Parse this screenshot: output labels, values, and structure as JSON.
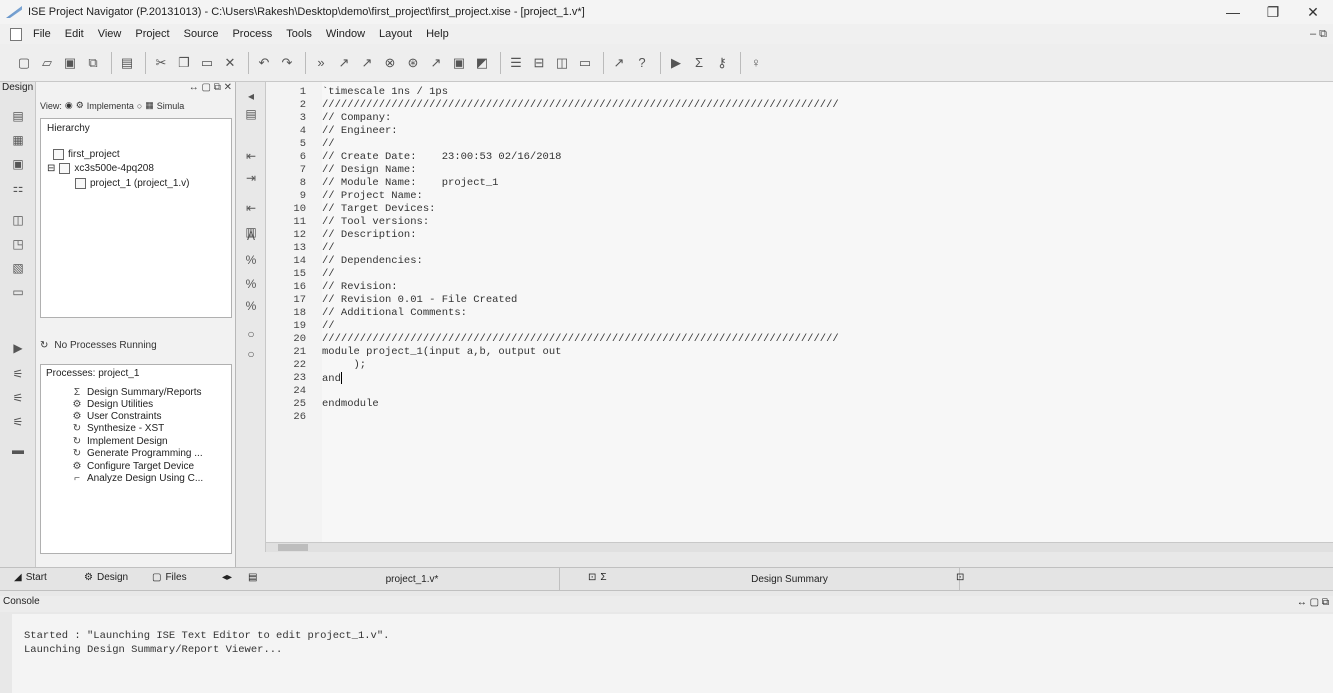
{
  "window": {
    "title": "ISE Project Navigator (P.20131013) - C:\\Users\\Rakesh\\Desktop\\demo\\first_project\\first_project.xise - [project_1.v*]",
    "minimize": "—",
    "restore": "❐",
    "close": "✕"
  },
  "menu": [
    "File",
    "Edit",
    "View",
    "Project",
    "Source",
    "Process",
    "Tools",
    "Window",
    "Layout",
    "Help"
  ],
  "toolbar_icons": [
    "new-icon",
    "open-icon",
    "save-icon",
    "save-all-icon",
    "print-icon",
    "cut-icon",
    "copy-icon",
    "paste-icon",
    "delete-icon",
    "undo-icon",
    "redo-icon",
    "more-icon",
    "implement-icon",
    "check-icon",
    "probe-icon",
    "find-icon",
    "zoom-icon",
    "view-icon",
    "layout-icon",
    "tile-icon",
    "panel-icon",
    "restore-icon",
    "help-icon",
    "whats-this-icon",
    "run-icon",
    "sigma-icon",
    "key-icon",
    "bulb-icon"
  ],
  "design_panel": {
    "header": "Design",
    "controls": "↔ ▢ ⧉ ✕",
    "view_label": "View:",
    "view_implement": "Implementa",
    "view_simulation": "Simula",
    "hierarchy_title": "Hierarchy",
    "tree": [
      {
        "label": "first_project"
      },
      {
        "label": "xc3s500e-4pq208"
      },
      {
        "label": "project_1 (project_1.v)"
      }
    ],
    "process_status": "No Processes Running",
    "processes_title": "Processes: project_1",
    "processes": [
      {
        "label": "Design Summary/Reports",
        "icon": "Σ"
      },
      {
        "label": "Design Utilities",
        "icon": "⚙"
      },
      {
        "label": "User Constraints",
        "icon": "⚙"
      },
      {
        "label": "Synthesize - XST",
        "icon": "↻"
      },
      {
        "label": "Implement Design",
        "icon": "↻"
      },
      {
        "label": "Generate Programming ...",
        "icon": "↻"
      },
      {
        "label": "Configure Target Device",
        "icon": "⚙"
      },
      {
        "label": "Analyze Design Using C...",
        "icon": "⌐"
      }
    ]
  },
  "editor": {
    "lines": [
      "`timescale 1ns / 1ps",
      "//////////////////////////////////////////////////////////////////////////////////",
      "// Company:",
      "// Engineer:",
      "//",
      "// Create Date:    23:00:53 02/16/2018",
      "// Design Name:",
      "// Module Name:    project_1",
      "// Project Name:",
      "// Target Devices:",
      "// Tool versions:",
      "// Description:",
      "//",
      "// Dependencies:",
      "//",
      "// Revision:",
      "// Revision 0.01 - File Created",
      "// Additional Comments:",
      "//",
      "//////////////////////////////////////////////////////////////////////////////////",
      "module project_1(input a,b, output out",
      "     );",
      "and",
      "",
      "endmodule",
      ""
    ],
    "line_numbers": [
      "1",
      "2",
      "3",
      "4",
      "5",
      "6",
      "7",
      "8",
      "9",
      "10",
      "11",
      "12",
      "13",
      "14",
      "15",
      "16",
      "17",
      "18",
      "19",
      "20",
      "21",
      "22",
      "23",
      "24",
      "25",
      "26"
    ]
  },
  "bottom_tabs": {
    "start": "Start",
    "design": "Design",
    "files": "Files",
    "doc_tab1": "project_1.v*",
    "doc_tab2": "Design Summary"
  },
  "console": {
    "header": "Console",
    "controls": "↔ ▢ ⧉",
    "lines": [
      "Started : \"Launching ISE Text Editor to edit project_1.v\".",
      "Launching Design Summary/Report Viewer..."
    ]
  }
}
